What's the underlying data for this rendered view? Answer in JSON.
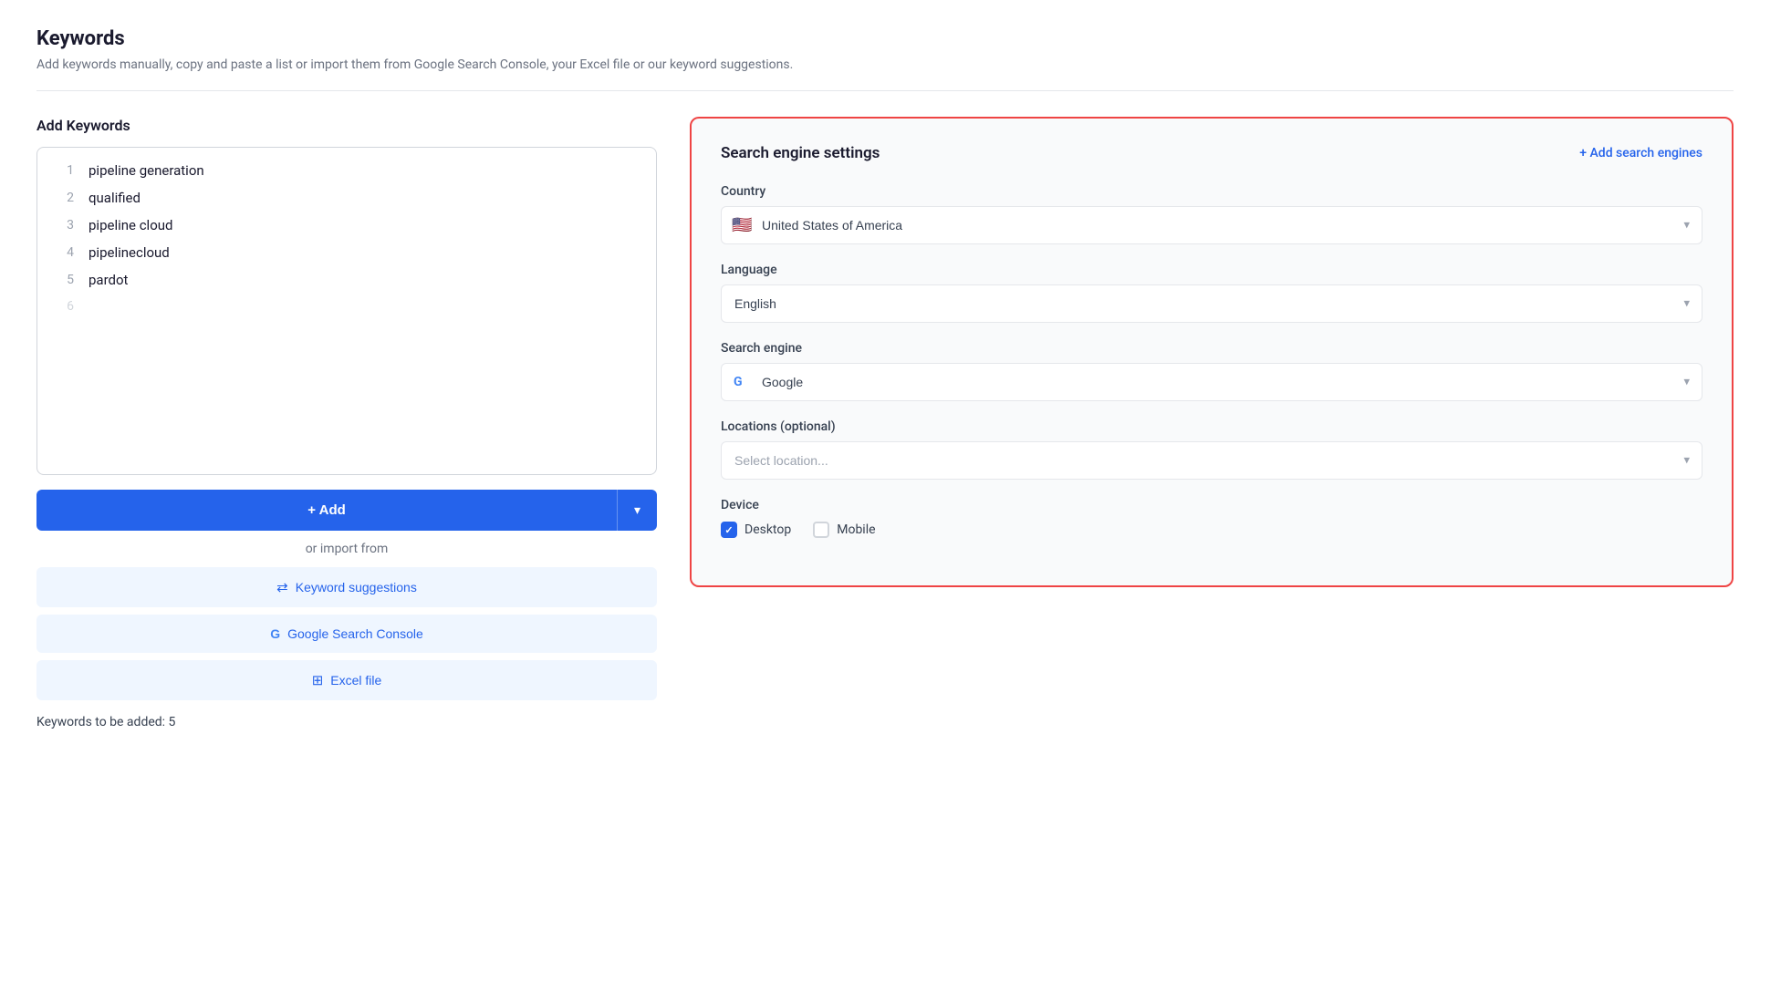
{
  "page": {
    "title": "Keywords",
    "subtitle": "Add keywords manually, copy and paste a list or import them from Google Search Console, your Excel file or our keyword suggestions."
  },
  "left_panel": {
    "section_title": "Add Keywords",
    "keywords": [
      {
        "num": "1",
        "text": "pipeline generation"
      },
      {
        "num": "2",
        "text": "qualified"
      },
      {
        "num": "3",
        "text": "pipeline cloud"
      },
      {
        "num": "4",
        "text": "pipelinecloud"
      },
      {
        "num": "5",
        "text": "pardot"
      },
      {
        "num": "6",
        "text": ""
      }
    ],
    "add_button_label": "+ Add",
    "or_import_label": "or import from",
    "keyword_suggestions_label": "Keyword suggestions",
    "google_search_console_label": "Google Search Console",
    "excel_file_label": "Excel file",
    "keywords_count_label": "Keywords to be added: 5"
  },
  "right_panel": {
    "title": "Search engine settings",
    "add_engines_label": "+ Add search engines",
    "country_label": "Country",
    "country_value": "United States of America",
    "country_flag": "🇺🇸",
    "language_label": "Language",
    "language_value": "English",
    "search_engine_label": "Search engine",
    "search_engine_value": "Google",
    "locations_label": "Locations (optional)",
    "locations_placeholder": "Select location...",
    "device_label": "Device",
    "desktop_label": "Desktop",
    "mobile_label": "Mobile",
    "desktop_checked": true,
    "mobile_checked": false
  }
}
